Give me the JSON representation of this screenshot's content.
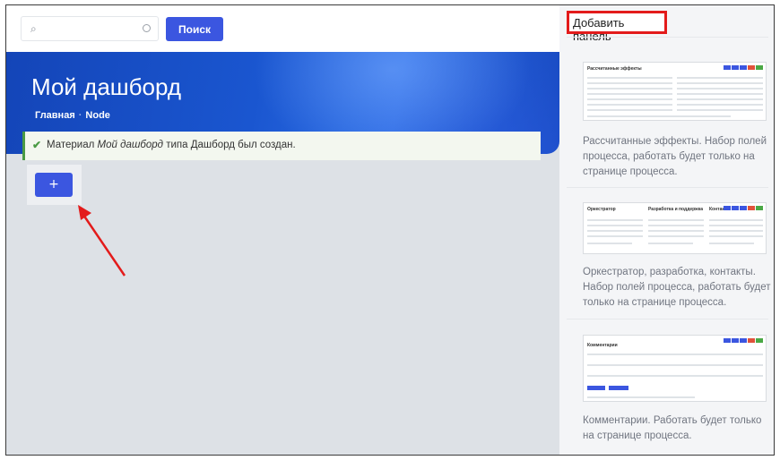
{
  "search": {
    "placeholder": "",
    "button_label": "Поиск"
  },
  "hero": {
    "title": "Мой дашборд",
    "breadcrumb": [
      "Главная",
      "Node"
    ]
  },
  "alert": {
    "prefix": "Материал ",
    "node_title": "Мой дашборд",
    "suffix": " типа Дашборд был создан."
  },
  "add_button": {
    "label": "+"
  },
  "panel": {
    "title": "Добавить панель",
    "items": [
      {
        "thumb_title": "Рассчитанные эффекты",
        "description": "Рассчитанные эффекты. Набор полей процесса, работать будет только на странице процесса."
      },
      {
        "thumb_titles": [
          "Оркестратор",
          "Разработка и поддержка",
          "Контакты"
        ],
        "description": "Оркестратор, разработка, контакты. Набор полей процесса, работать будет только на странице процесса."
      },
      {
        "thumb_title": "Комментарии",
        "description": "Комментарии. Работать будет только на странице процесса."
      }
    ]
  },
  "colors": {
    "accent": "#3b56e0",
    "highlight": "#e31b1b",
    "success": "#4a9a44"
  }
}
